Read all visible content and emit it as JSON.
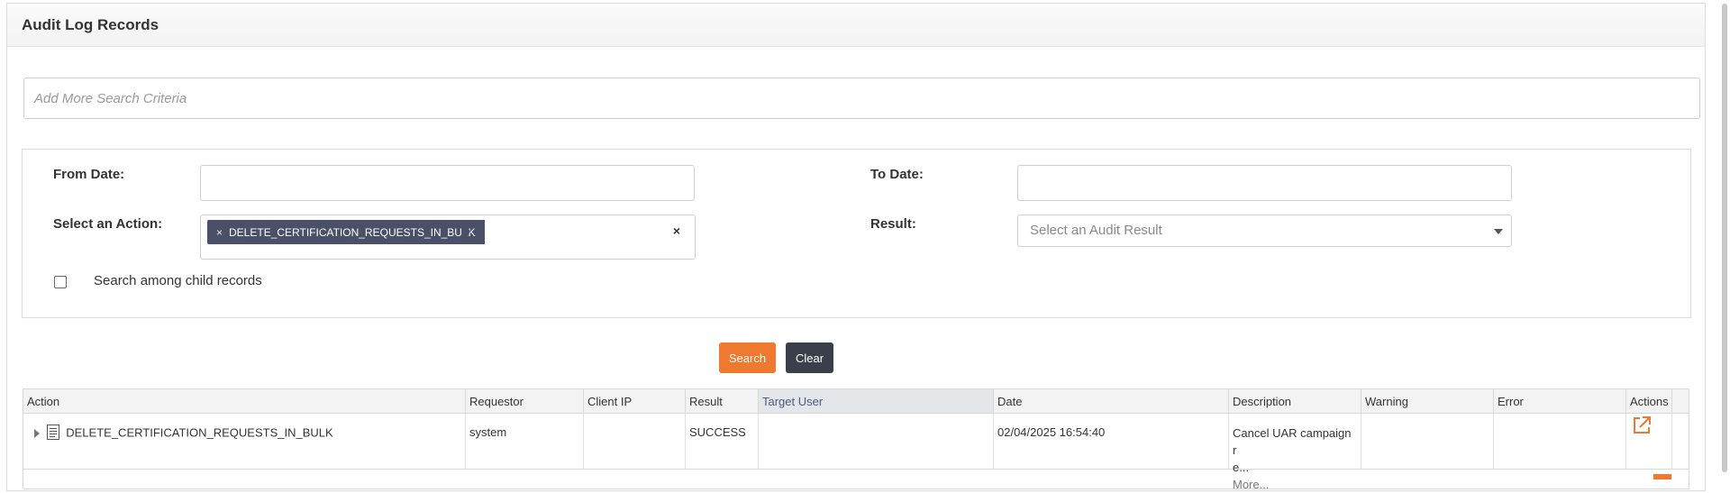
{
  "page": {
    "title": "Audit Log Records",
    "search_criteria_placeholder": "Add More Search Criteria"
  },
  "filters": {
    "from_date_label": "From Date:",
    "from_date_value": "",
    "to_date_label": "To Date:",
    "to_date_value": "",
    "action_label": "Select an Action:",
    "action_selected": [
      "DELETE_CERTIFICATION_REQUESTS_IN_BULK"
    ],
    "result_label": "Result:",
    "result_placeholder": "Select an Audit Result",
    "child_records_label": "Search among child records",
    "child_records_checked": false
  },
  "buttons": {
    "search": "Search",
    "clear": "Clear"
  },
  "table": {
    "columns": [
      "Action",
      "Requestor",
      "Client IP",
      "Result",
      "Target User",
      "Date",
      "Description",
      "Warning",
      "Error",
      "Actions"
    ],
    "sorted_column": "Target User",
    "rows": [
      {
        "action": "DELETE_CERTIFICATION_REQUESTS_IN_BULK",
        "requestor": "system",
        "client_ip": "",
        "result": "SUCCESS",
        "target_user": "",
        "date": "02/04/2025 16:54:40",
        "description_line1": "Cancel UAR campaign r",
        "description_line2": "e...",
        "description_more": "More...",
        "warning": "",
        "error": ""
      }
    ]
  },
  "colors": {
    "accent": "#ef7a2f",
    "tag": "#4a5068",
    "dark_button": "#3a3f4b"
  }
}
